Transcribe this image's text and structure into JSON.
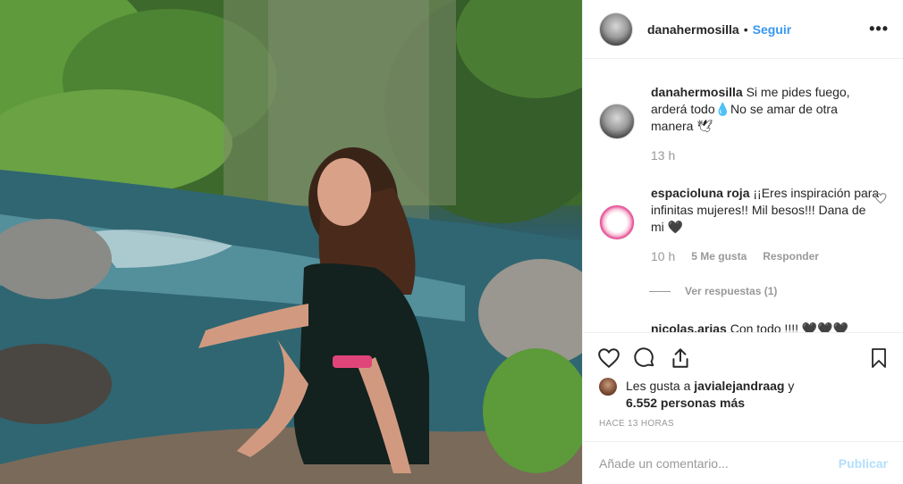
{
  "post": {
    "username": "danahermosilla",
    "follow_label": "Seguir",
    "separator": "•",
    "more_icon": "•••"
  },
  "caption": {
    "username": "danahermosilla",
    "text": "Si me pides fuego, arderá todo💧No se amar de otra manera 🕊",
    "time": "13 h"
  },
  "comments": [
    {
      "username": "espacioluna roja",
      "text": "¡¡Eres inspiración para infinitas mujeres!! Mil besos!!! Dana de mi 🖤",
      "time": "10 h",
      "likes": "5 Me gusta",
      "reply_label": "Responder",
      "view_replies": "Ver respuestas (1)"
    },
    {
      "username": "nicolas.arias",
      "text": "Con todo !!!! 🖤🖤🖤"
    }
  ],
  "likes": {
    "prefix": "Les gusta a ",
    "user": "javialejandraag",
    "middle": " y ",
    "count": "6.552 personas más"
  },
  "timestamp": "HACE 13 HORAS",
  "add_comment": {
    "placeholder": "Añade un comentario...",
    "publish_label": "Publicar"
  },
  "colors": {
    "link_blue": "#3897f0",
    "publish_disabled": "#b2dffc",
    "meta_gray": "#999999"
  }
}
